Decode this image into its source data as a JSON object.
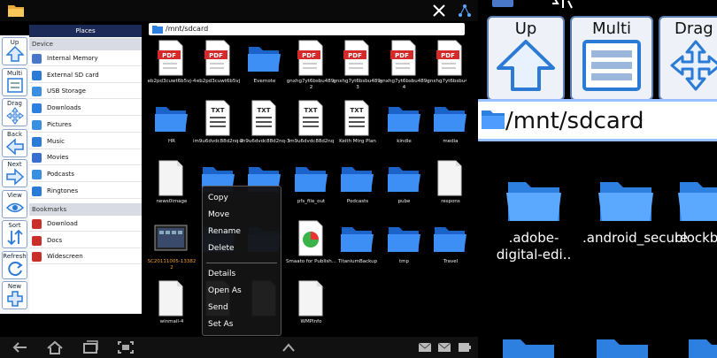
{
  "left": {
    "places_header": "Places",
    "toolbar": [
      {
        "label": "Up",
        "icon": "up-arrow-icon"
      },
      {
        "label": "Multi",
        "icon": "multi-select-icon"
      },
      {
        "label": "Drag",
        "icon": "drag-icon"
      },
      {
        "label": "Back",
        "icon": "back-arrow-icon"
      },
      {
        "label": "Next",
        "icon": "next-arrow-icon"
      },
      {
        "label": "View",
        "icon": "eye-icon"
      },
      {
        "label": "Sort",
        "icon": "sort-icon"
      },
      {
        "label": "Refresh",
        "icon": "refresh-icon"
      },
      {
        "label": "New",
        "icon": "plus-icon"
      }
    ],
    "sections": {
      "device": "Device",
      "bookmarks": "Bookmarks"
    },
    "device_items": [
      {
        "label": "Internal Memory",
        "icon": "memory-icon"
      },
      {
        "label": "External SD card",
        "icon": "sd-card-icon"
      },
      {
        "label": "USB Storage",
        "icon": "usb-icon"
      },
      {
        "label": "Downloads",
        "icon": "downloads-icon"
      },
      {
        "label": "Pictures",
        "icon": "pictures-icon"
      },
      {
        "label": "Music",
        "icon": "music-icon"
      },
      {
        "label": "Movies",
        "icon": "movies-icon"
      },
      {
        "label": "Podcasts",
        "icon": "podcasts-icon"
      },
      {
        "label": "Ringtones",
        "icon": "ringtones-icon"
      }
    ],
    "bookmark_items": [
      {
        "label": "Download",
        "icon": "bookmark-icon"
      },
      {
        "label": "Docs",
        "icon": "bookmark-icon"
      },
      {
        "label": "Widescreen",
        "icon": "bookmark-icon"
      }
    ],
    "path": "/mnt/sdcard",
    "files_row1": [
      {
        "name": "eb2pd3cuwt6b5vj-4",
        "type": "pdf"
      },
      {
        "name": "eb2pd3cuwt6b5vj",
        "type": "pdf"
      },
      {
        "name": "Evernote",
        "type": "folder"
      },
      {
        "name": "gnxhg7yt6bsbu489-2",
        "type": "pdf"
      },
      {
        "name": "gnxhg7yt6bsbu489-3",
        "type": "pdf"
      },
      {
        "name": "gnxhg7yt6bsbu489-4",
        "type": "pdf"
      },
      {
        "name": "gnxhg7yt6bsbu489",
        "type": "pdf"
      }
    ],
    "files_row2": [
      {
        "name": "HR",
        "type": "folder"
      },
      {
        "name": "im9u6dvdc88d2nq-2",
        "type": "txt"
      },
      {
        "name": "im9u6dvdc88d2nq-3",
        "type": "txt"
      },
      {
        "name": "im9u6dvdc88d2nq",
        "type": "txt"
      },
      {
        "name": "Keith Mtrg Plan",
        "type": "txt"
      },
      {
        "name": "kindle",
        "type": "folder"
      },
      {
        "name": "media",
        "type": "folder"
      }
    ],
    "files_row3": [
      {
        "name": "news0image",
        "type": "doc"
      },
      {
        "name": "",
        "type": "folder"
      },
      {
        "name": "",
        "type": "folder"
      },
      {
        "name": "pfs_file_out",
        "type": "folder"
      },
      {
        "name": "Podcasts",
        "type": "folder"
      },
      {
        "name": "pube",
        "type": "folder"
      },
      {
        "name": "respons",
        "type": "doc"
      }
    ],
    "files_row4": [
      {
        "name": "SC20111005-133822",
        "type": "image"
      },
      {
        "name": "",
        "type": "folder"
      },
      {
        "name": "",
        "type": "folder"
      },
      {
        "name": "Smaato for Publish...",
        "type": "app"
      },
      {
        "name": "TitaniumBackup",
        "type": "folder"
      },
      {
        "name": "tmp",
        "type": "folder"
      },
      {
        "name": "Travel",
        "type": "folder"
      }
    ],
    "files_row5": [
      {
        "name": "winmail-4",
        "type": "doc"
      },
      {
        "name": "",
        "type": "doc"
      },
      {
        "name": "",
        "type": "doc"
      },
      {
        "name": "WMPInfo",
        "type": "doc"
      }
    ],
    "context_menu": [
      "Copy",
      "Move",
      "Rename",
      "Delete",
      "Details",
      "Open As",
      "Send",
      "Set As"
    ],
    "file_labels": {
      "pdf": "PDF",
      "txt": "TXT"
    }
  },
  "right": {
    "buttons": [
      {
        "label": "Up",
        "icon": "up-arrow-icon"
      },
      {
        "label": "Multi",
        "icon": "multi-select-icon"
      },
      {
        "label": "Drag",
        "icon": "drag-icon"
      }
    ],
    "path": "/mnt/sdcard",
    "folders": [
      {
        "name": ".adobe-digital-edi.."
      },
      {
        "name": ".android_secure"
      },
      {
        "name": "blockbu"
      }
    ]
  },
  "colors": {
    "accent": "#1c6fd1",
    "folder": "#2d7fe0",
    "pdf": "#d42a2a"
  }
}
